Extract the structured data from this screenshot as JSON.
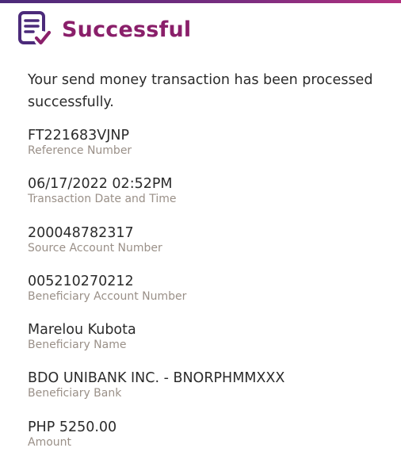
{
  "header": {
    "icon": "document-check-icon",
    "title": "Successful",
    "accent_color": "#8a1f6a",
    "icon_color": "#4b2a7a"
  },
  "message": "Your send money transaction has been processed successfully.",
  "fields": [
    {
      "value": "FT221683VJNP",
      "label": "Reference Number"
    },
    {
      "value": "06/17/2022 02:52PM",
      "label": "Transaction Date and Time"
    },
    {
      "value": "200048782317",
      "label": "Source Account Number"
    },
    {
      "value": "005210270212",
      "label": "Beneficiary Account Number"
    },
    {
      "value": "Marelou Kubota",
      "label": "Beneficiary Name"
    },
    {
      "value": "BDO UNIBANK INC. - BNORPHMMXXX",
      "label": "Beneficiary Bank"
    },
    {
      "value": "PHP 5250.00",
      "label": "Amount"
    }
  ]
}
